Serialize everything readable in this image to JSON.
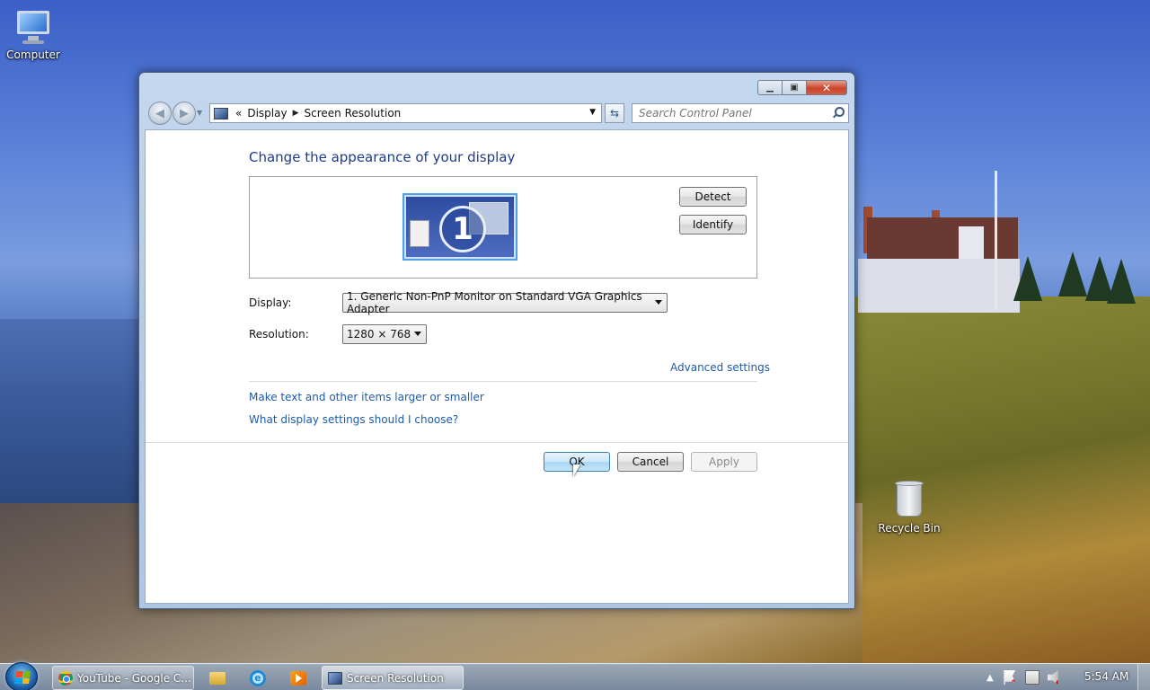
{
  "desktop": {
    "icons": [
      {
        "label": "Computer",
        "icon": "computer-icon"
      },
      {
        "label": "Recycle Bin",
        "icon": "recycle-bin-icon"
      }
    ]
  },
  "window": {
    "title": "Screen Resolution",
    "caption_buttons": {
      "minimize": "minimize-icon",
      "maximize": "maximize-icon",
      "close": "close-icon"
    },
    "breadcrumb": {
      "lead": "«",
      "items": [
        "Display",
        "Screen Resolution"
      ]
    },
    "search": {
      "placeholder": "Search Control Panel"
    },
    "heading": "Change the appearance of your display",
    "monitor_number": "1",
    "detect_label": "Detect",
    "identify_label": "Identify",
    "display_label": "Display:",
    "display_value": "1. Generic Non-PnP Monitor on Standard VGA Graphics Adapter",
    "resolution_label": "Resolution:",
    "resolution_value": "1280 × 768",
    "advanced_link": "Advanced settings",
    "links": [
      "Make text and other items larger or smaller",
      "What display settings should I choose?"
    ],
    "ok_label": "OK",
    "cancel_label": "Cancel",
    "apply_label": "Apply"
  },
  "taskbar": {
    "items": [
      {
        "label": "YouTube - Google C...",
        "icon": "chrome-icon"
      },
      {
        "label": "Screen Resolution",
        "icon": "screen-resolution-icon",
        "active": true
      }
    ],
    "pinned": [
      "file-explorer-icon",
      "internet-explorer-icon",
      "media-player-icon"
    ],
    "clock": "5:54 AM"
  },
  "colors": {
    "link": "#1e5aa8",
    "heading": "#1e3b8a",
    "accent_blue": "#4ea0e8"
  }
}
